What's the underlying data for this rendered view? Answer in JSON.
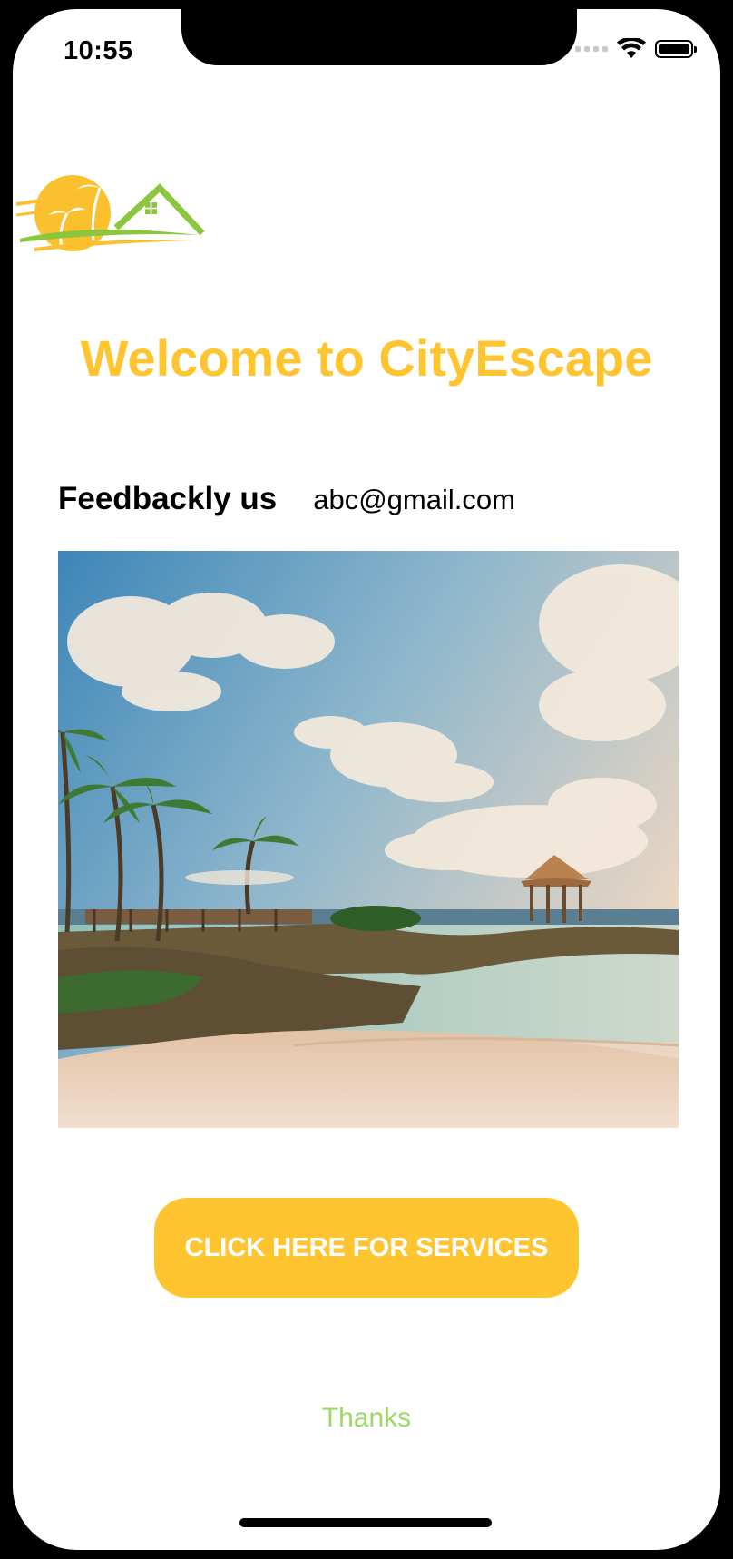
{
  "status_bar": {
    "time": "10:55",
    "icons": [
      "cellular-signal-icon",
      "wifi-icon",
      "battery-icon"
    ]
  },
  "header": {
    "logo": "palm-beach-house-logo",
    "welcome_title": "Welcome to CityEscape"
  },
  "feedback": {
    "label": "Feedbackly us",
    "email": "abc@gmail.com"
  },
  "hero_image": "beach-resort-photo",
  "actions": {
    "services_button": "CLICK HERE FOR SERVICES"
  },
  "footer": {
    "thanks": "Thanks"
  },
  "colors": {
    "accent": "#FFC531",
    "thanks_text": "#9AD96A",
    "logo_green": "#8CC63F"
  }
}
